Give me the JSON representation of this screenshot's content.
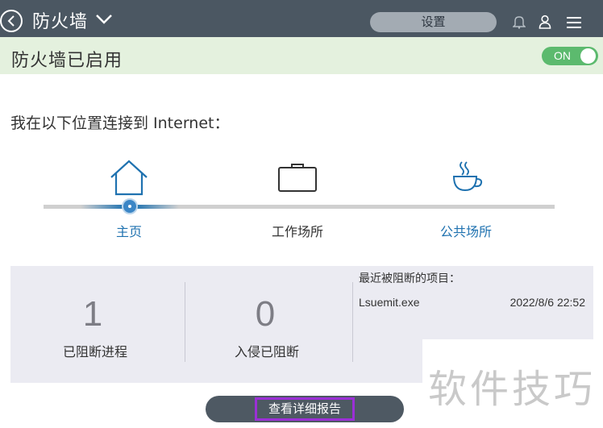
{
  "header": {
    "title": "防火墙",
    "settings_label": "设置",
    "icons": [
      "back-icon",
      "chevron-down-icon",
      "bell-icon",
      "user-icon",
      "menu-icon"
    ]
  },
  "status": {
    "text": "防火墙已启用",
    "toggle_label": "ON",
    "toggle_on": true,
    "toggle_color": "#5cba6e"
  },
  "prompt": "我在以下位置连接到 Internet：",
  "locations": [
    {
      "label": "主页",
      "icon": "home-icon",
      "selected": true
    },
    {
      "label": "工作场所",
      "icon": "briefcase-icon",
      "selected": false
    },
    {
      "label": "公共场所",
      "icon": "coffee-cup-icon",
      "selected": false
    }
  ],
  "stats": {
    "processes_blocked_count": "1",
    "processes_blocked_label": "已阻断进程",
    "intrusions_blocked_count": "0",
    "intrusions_blocked_label": "入侵已阻断"
  },
  "recent_blocked": {
    "title": "最近被阻断的项目：",
    "items": [
      {
        "name": "Lsuemit.exe",
        "time": "2022/8/6 22:52"
      }
    ]
  },
  "report_button": "查看详细报告",
  "watermark": "软件技巧",
  "colors": {
    "header_bg": "#4b5762",
    "status_bg": "#e4f1de",
    "accent_blue": "#1f72b0",
    "highlight_purple": "#9b2fd6"
  }
}
